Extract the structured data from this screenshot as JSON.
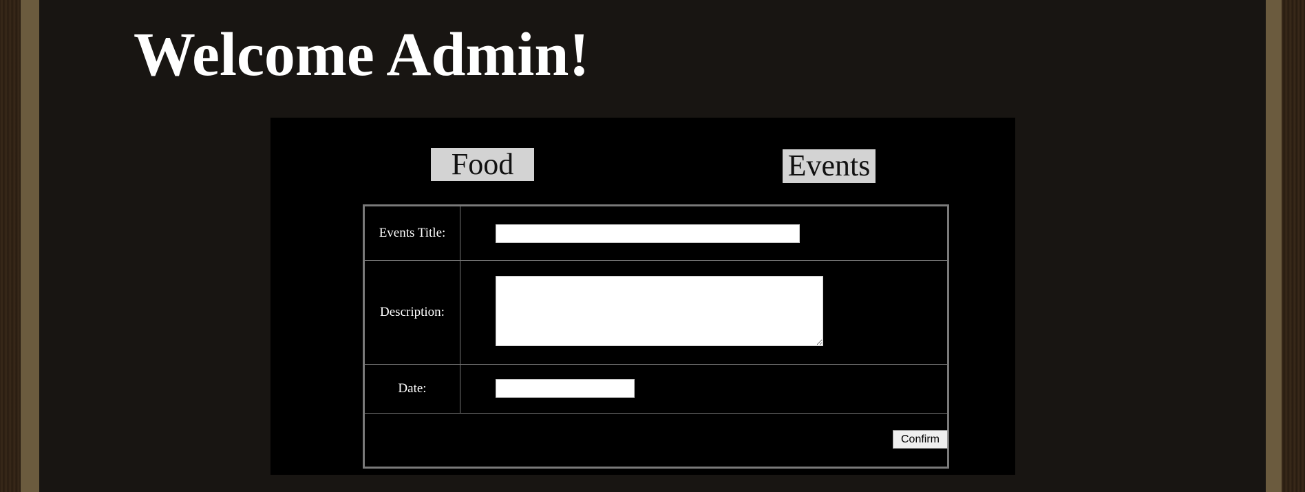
{
  "header": {
    "welcome_text": "Welcome Admin!"
  },
  "nav": {
    "food_label": "Food",
    "events_label": "Events"
  },
  "form": {
    "title_label": "Events Title:",
    "title_value": "",
    "description_label": "Description:",
    "description_value": "",
    "date_label": "Date:",
    "date_value": "",
    "confirm_label": "Confirm"
  },
  "colors": {
    "page_background": "#181512",
    "frame": "#6b5b3e",
    "form_background": "#000000",
    "nav_button": "#d3d3d3",
    "text": "#ffffff"
  }
}
